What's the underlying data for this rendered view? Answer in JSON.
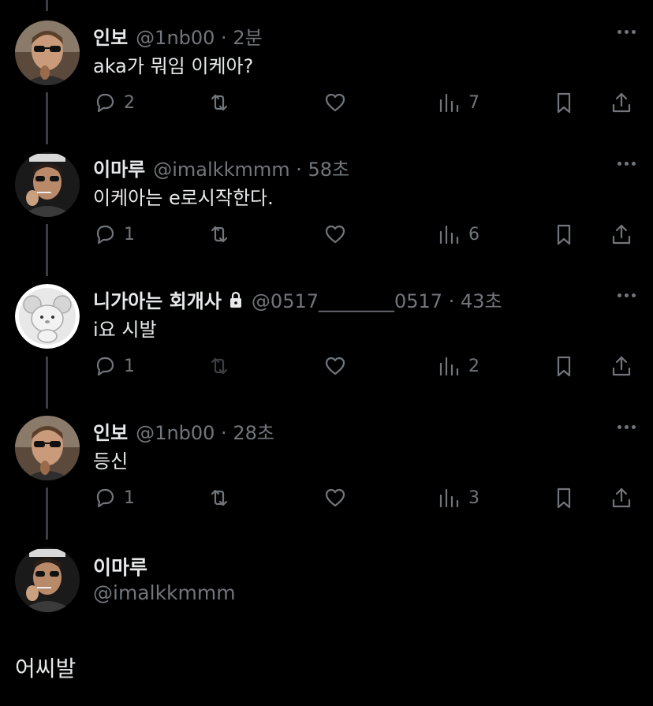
{
  "tweets": [
    {
      "name": "인보",
      "handle": "@1nb00 · 2분",
      "text": "aka가 뭐임 이케아?",
      "replies": "2",
      "views": "7",
      "locked": false,
      "retweet_disabled": false
    },
    {
      "name": "이마루",
      "handle": "@imalkkmmm · 58초",
      "text": "이케아는 e로시작한다.",
      "replies": "1",
      "views": "6",
      "locked": false,
      "retweet_disabled": false
    },
    {
      "name": "니가아는 회개사",
      "handle": "@0517________0517 · 43초",
      "text": "i요 시발",
      "replies": "1",
      "views": "2",
      "locked": true,
      "retweet_disabled": true
    },
    {
      "name": "인보",
      "handle": "@1nb00 · 28초",
      "text": "등신",
      "replies": "1",
      "views": "3",
      "locked": false,
      "retweet_disabled": false
    }
  ],
  "main_tweet": {
    "name": "이마루",
    "handle": "@imalkkmmm",
    "text": "어씨발"
  },
  "icons": {
    "reply": "reply-icon",
    "retweet": "retweet-icon",
    "like": "heart-icon",
    "views": "views-chart-icon",
    "bookmark": "bookmark-icon",
    "share": "share-icon",
    "more": "more-dots-icon",
    "lock": "lock-icon"
  },
  "colors": {
    "background": "#000000",
    "text": "#e7e9ea",
    "secondary": "#71767b",
    "thread_line": "#3a3d41"
  }
}
